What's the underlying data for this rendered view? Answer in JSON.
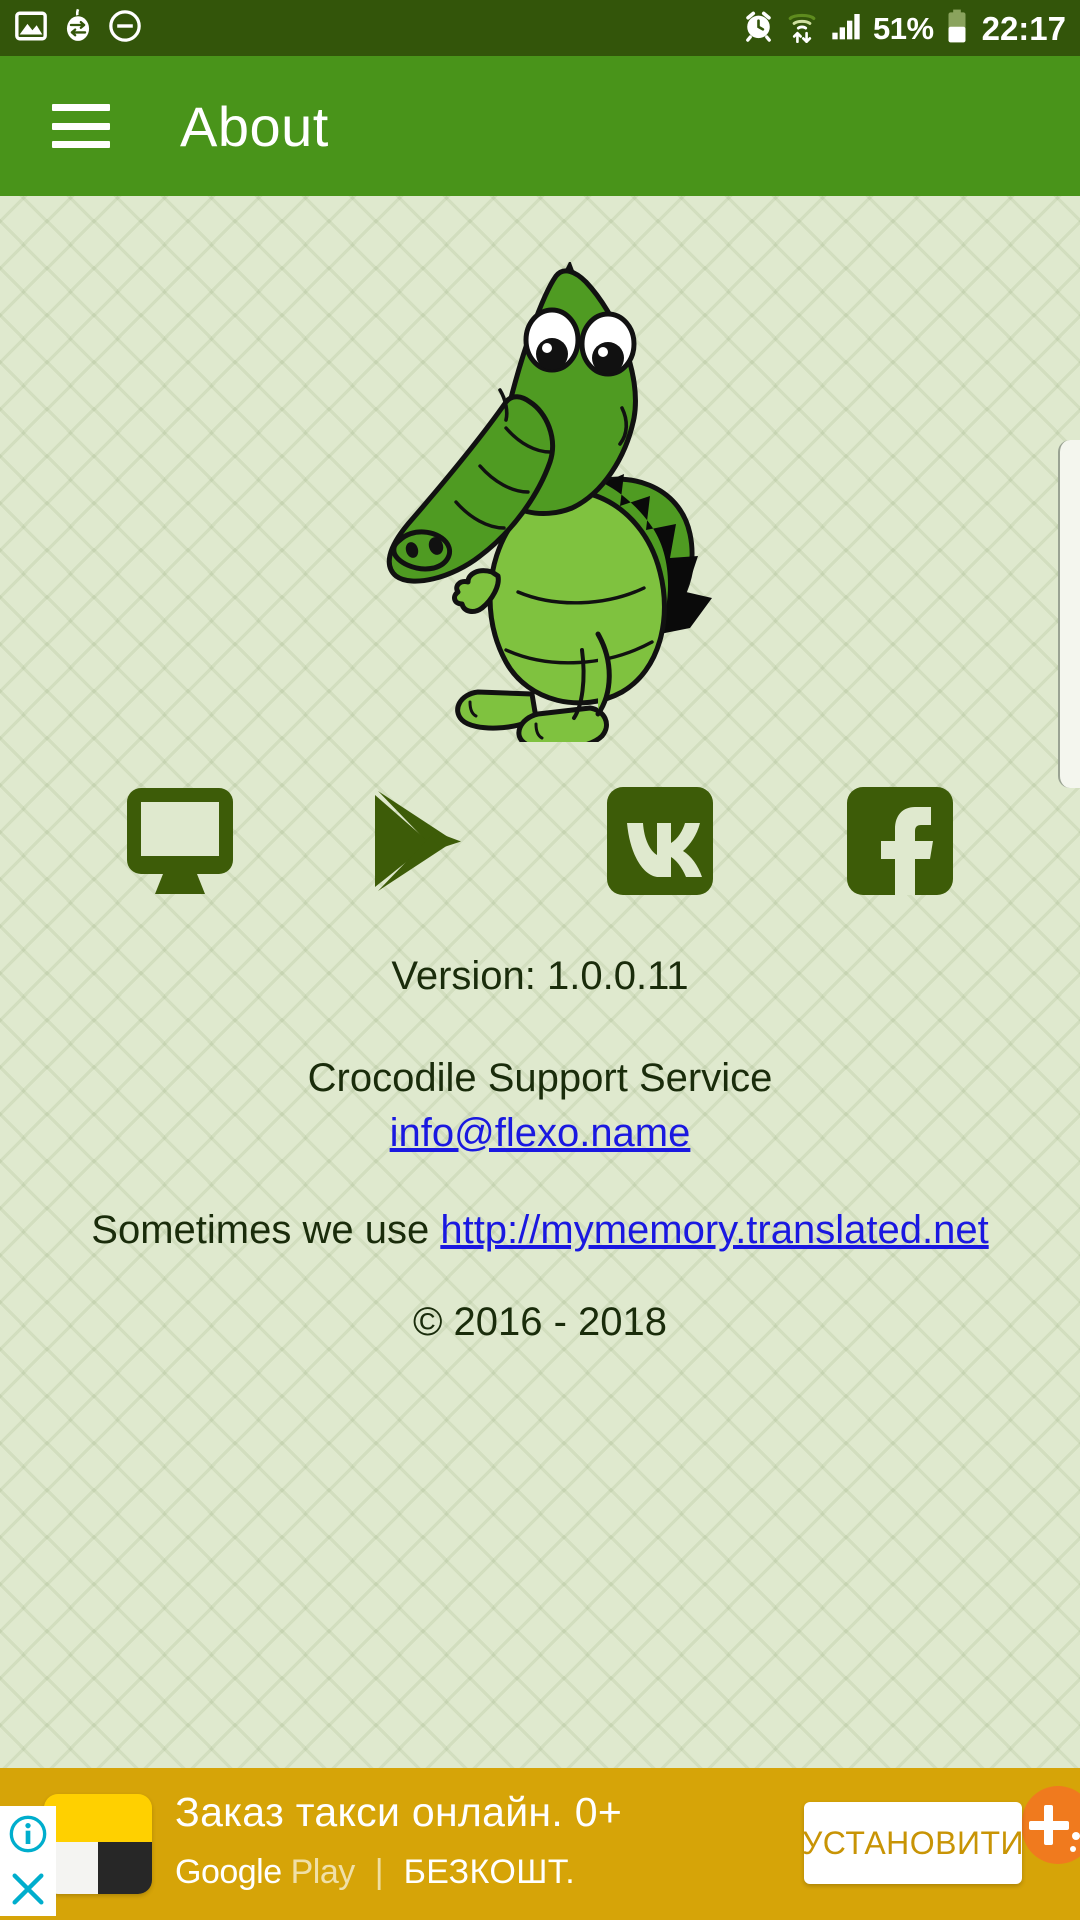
{
  "status_bar": {
    "left_icons": [
      "gallery-image-icon",
      "translate-swap-icon",
      "do-not-disturb-icon"
    ],
    "alarm_icon": "alarm-clock-icon",
    "wifi_icon": "wifi-transfer-icon",
    "signal_icon": "cellular-signal-icon",
    "battery_percent": "51%",
    "battery_icon": "battery-half-icon",
    "clock": "22:17",
    "background_color": "#33550a",
    "foreground_color": "#ffffff"
  },
  "app_bar": {
    "menu_icon": "hamburger-menu-icon",
    "title": "About",
    "background_color": "#49941a",
    "text_color": "#ffffff"
  },
  "content": {
    "background_color": "#dfe9ce",
    "mascot": "crocodile-mascot-illustration",
    "social_links": [
      {
        "name": "website-link",
        "icon": "desktop-monitor-icon",
        "label": "Website"
      },
      {
        "name": "google-play-link",
        "icon": "google-play-icon",
        "label": "Google Play"
      },
      {
        "name": "vk-link",
        "icon": "vk-icon",
        "label": "VK"
      },
      {
        "name": "facebook-link",
        "icon": "facebook-icon",
        "label": "Facebook"
      }
    ],
    "icon_color": "#3d5c08",
    "version_line": "Version: 1.0.0.11",
    "support_title": "Crocodile Support Service",
    "support_email": "info@flexo.name",
    "mymemory_prefix": "Sometimes we use ",
    "mymemory_link": "http://mymemory.translated.net",
    "copyright": "© 2016 - 2018",
    "link_color": "#1a18e0",
    "text_color": "#1a2c0b"
  },
  "ad": {
    "info_icon": "ad-info-icon",
    "close_icon": "ad-close-icon",
    "app_icon": "yandex-taxi-app-icon",
    "headline": "Заказ такси онлайн. 0+",
    "store_brand_g": "Google",
    "store_brand_play": " Play",
    "divider": "|",
    "price_label": "БЕЗКОШТ.",
    "cta_label": "УСТАНОВИТИ",
    "background_color": "#d6a408",
    "cta_text_color": "#c89405",
    "badge_icon": "ad-choices-plus-icon"
  }
}
